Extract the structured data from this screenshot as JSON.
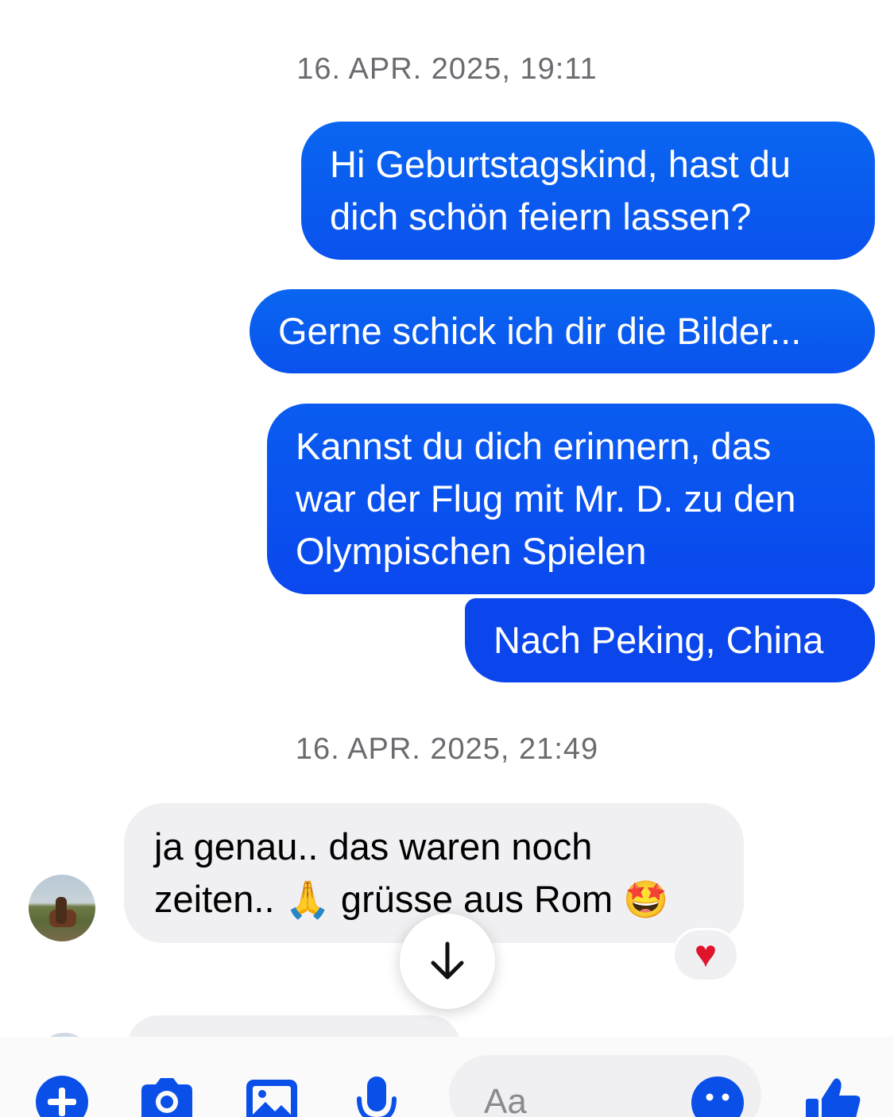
{
  "conversation": {
    "timestamps": [
      "16. APR. 2025, 19:11",
      "16. APR. 2025, 21:49"
    ],
    "outgoing": [
      {
        "line1": "Hi Geburtstagskind, hast du",
        "line2": "dich schön feiern lassen?"
      },
      {
        "line1": "Gerne schick ich dir die Bilder..."
      },
      {
        "line1": "Kannst du dich erinnern, das",
        "line2": "war der Flug mit Mr. D. zu den",
        "line3": "Olympischen Spielen"
      },
      {
        "line1": "Nach Peking, China"
      }
    ],
    "incoming": [
      {
        "line1": "ja genau.. das waren noch",
        "line2a": "zeiten.. ",
        "emoji1": "🙏",
        "line2b": " grüsse aus Rom ",
        "emoji2": "🤩",
        "reaction": "♥"
      }
    ]
  },
  "composer": {
    "placeholder": "Aa",
    "icons": [
      "plus-icon",
      "camera-icon",
      "image-icon",
      "microphone-icon",
      "emoji-icon",
      "thumbs-up-icon"
    ]
  },
  "colors": {
    "outgoing_bubble": "#0a5cf0",
    "incoming_bubble": "#f0f0f3",
    "accent": "#0a50e8",
    "reaction_heart": "#e0142b"
  }
}
